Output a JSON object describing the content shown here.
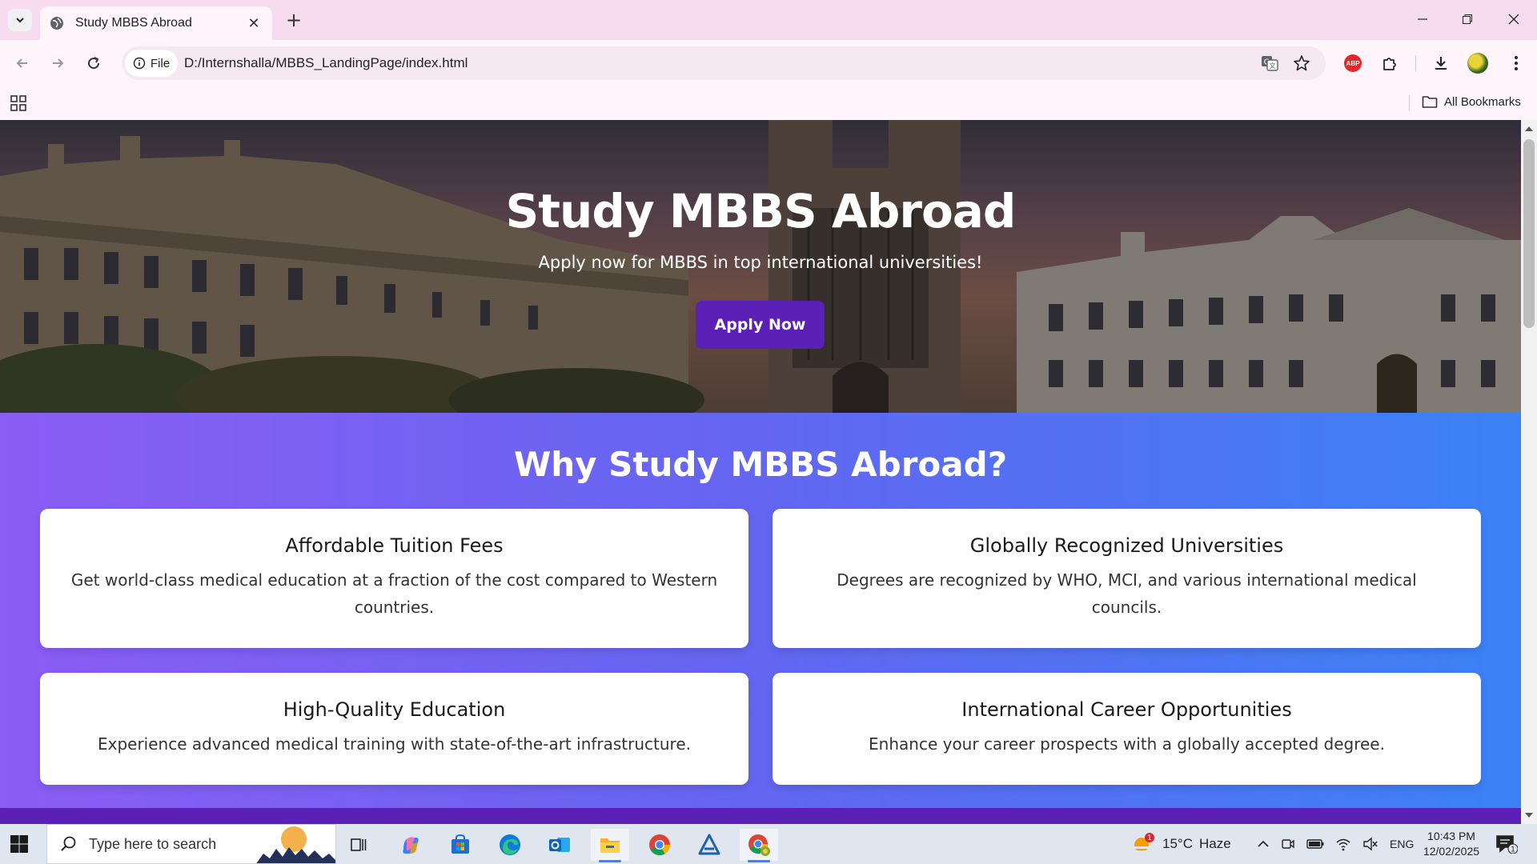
{
  "browser": {
    "tab_title": "Study MBBS Abroad",
    "new_tab": "+",
    "address_chip": "File",
    "url": "D:/Internshalla/MBBS_LandingPage/index.html",
    "bookmarks_label": "All Bookmarks",
    "abp_label": "ABP"
  },
  "hero": {
    "title": "Study MBBS Abroad",
    "subtitle": "Apply now for MBBS in top international universities!",
    "cta": "Apply Now"
  },
  "why": {
    "heading": "Why Study MBBS Abroad?",
    "cards": [
      {
        "title": "Affordable Tuition Fees",
        "text": "Get world-class medical education at a fraction of the cost compared to Western countries."
      },
      {
        "title": "Globally Recognized Universities",
        "text": "Degrees are recognized by WHO, MCI, and various international medical councils."
      },
      {
        "title": "High-Quality Education",
        "text": "Experience advanced medical training with state-of-the-art infrastructure."
      },
      {
        "title": "International Career Opportunities",
        "text": "Enhance your career prospects with a globally accepted degree."
      }
    ]
  },
  "taskbar": {
    "search_placeholder": "Type here to search",
    "weather_temp": "15°C",
    "weather_desc": "Haze",
    "weather_badge": "1",
    "lang": "ENG",
    "time": "10:43 PM",
    "date": "12/02/2025",
    "notification_count": "1"
  },
  "colors": {
    "accent_purple": "#5b21b6",
    "gradient_start": "#8b5cf6",
    "gradient_end": "#3b82f6",
    "tabbar": "#f7dcef"
  }
}
